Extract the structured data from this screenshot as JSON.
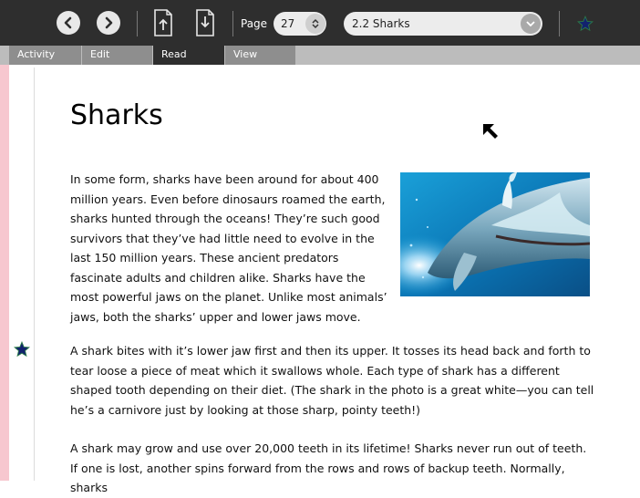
{
  "toolbar": {
    "back_icon": "back-arrow-icon",
    "forward_icon": "forward-arrow-icon",
    "page_label": "Page",
    "page_number": "27",
    "chapter": "2.2 Sharks"
  },
  "tabs": [
    {
      "label": "Activity"
    },
    {
      "label": "Edit"
    },
    {
      "label": "Read"
    },
    {
      "label": "View"
    }
  ],
  "active_tab": "Read",
  "article": {
    "title": "Sharks",
    "paragraphs": [
      "In some form, sharks have been around for about 400 million years. Even before dinosaurs roamed the earth, sharks hunted through the oceans! They’re such good survivors that they’ve had little need to evolve in the last 150 million years. These ancient predators fascinate adults and children alike. Sharks have the most powerful jaws on the planet. Unlike most animals’ jaws, both the sharks’ upper and lower jaws move.",
      "A shark bites with it’s lower jaw first and then its upper. It tosses its head back and forth to tear loose a piece of meat which it swallows whole. Each type of shark has a different shaped tooth depending on their diet. (The shark in the photo is a great white—you can tell he’s a carnivore just by looking at those sharp, pointy teeth!)",
      "A shark may grow and use over 20,000 teeth in its lifetime! Sharks never run out of teeth. If one is lost, another spins forward from the rows and rows of backup teeth. Normally, sharks"
    ]
  },
  "colors": {
    "toolbar_bg": "#2e2e2e",
    "tab_inactive": "#8e8e8e",
    "tab_active": "#2e2e2e",
    "bookmark_star": "#12226e",
    "left_strip": "#f7c7cf"
  }
}
